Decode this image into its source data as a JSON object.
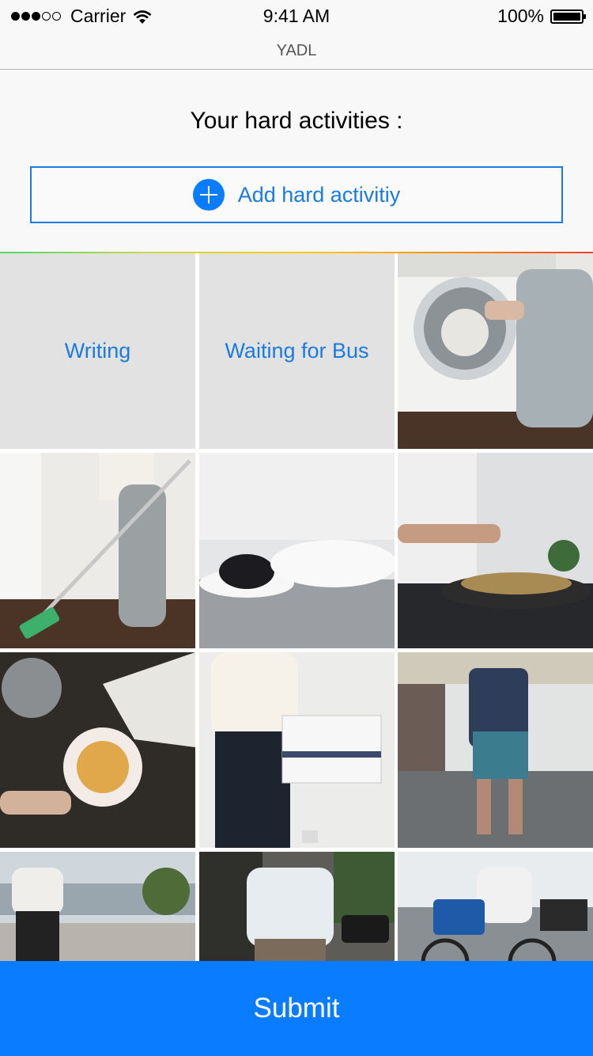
{
  "status_bar": {
    "carrier": "Carrier",
    "time": "9:41 AM",
    "battery": "100%",
    "signal_dots_full": 3,
    "signal_dots_empty": 2
  },
  "nav": {
    "title": "YADL"
  },
  "main": {
    "heading": "Your hard activities :",
    "add_button_label": "Add hard activitiy"
  },
  "tiles": [
    {
      "type": "text",
      "label": "Writing"
    },
    {
      "type": "text",
      "label": "Waiting for Bus"
    },
    {
      "type": "photo",
      "depicts": "laundry"
    },
    {
      "type": "photo",
      "depicts": "mopping"
    },
    {
      "type": "photo",
      "depicts": "lying-in-bed"
    },
    {
      "type": "photo",
      "depicts": "cooking"
    },
    {
      "type": "photo",
      "depicts": "tea"
    },
    {
      "type": "photo",
      "depicts": "carrying-box"
    },
    {
      "type": "photo",
      "depicts": "subway-platform"
    },
    {
      "type": "photo",
      "depicts": "walking-waterfront"
    },
    {
      "type": "photo",
      "depicts": "walking-street"
    },
    {
      "type": "photo",
      "depicts": "bike-share"
    }
  ],
  "submit_label": "Submit",
  "colors": {
    "accent": "#0a7cff",
    "link_text": "#1a7be0",
    "tile_bg": "#e2e2e2"
  }
}
